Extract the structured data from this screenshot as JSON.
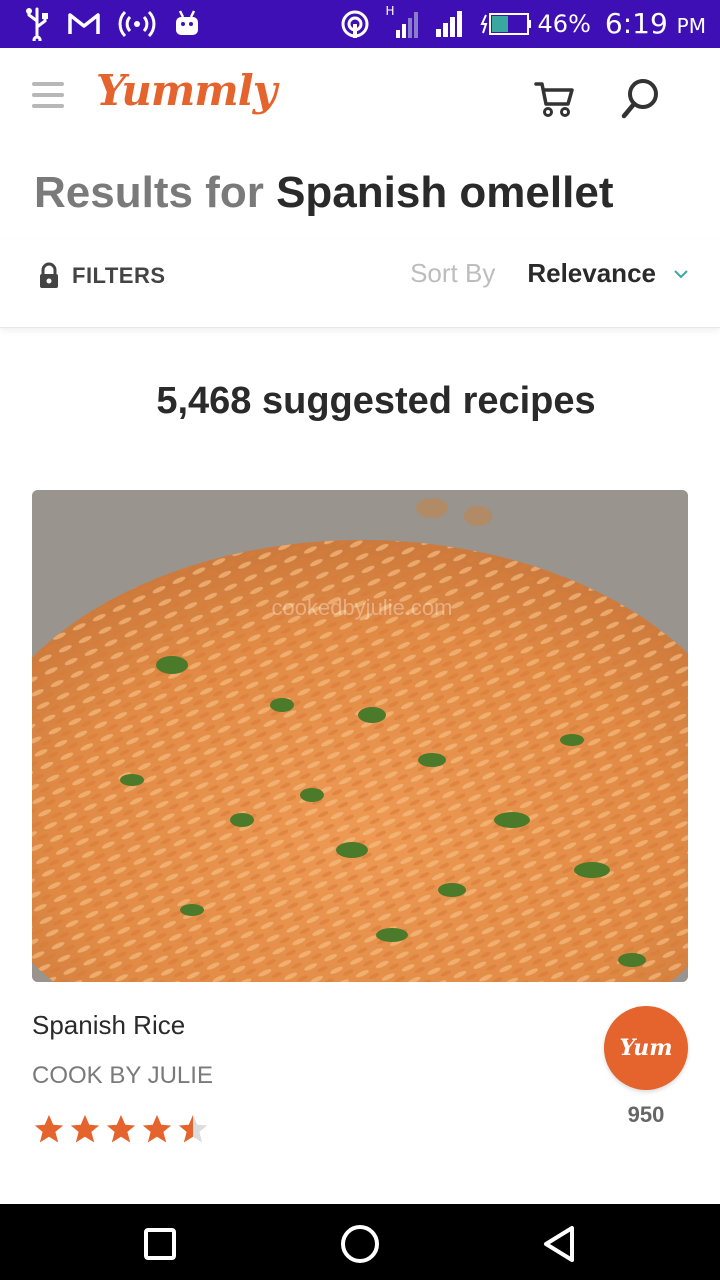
{
  "status_bar": {
    "battery": "46%",
    "time": "6:19",
    "ampm": "PM",
    "network_label": "H"
  },
  "app": {
    "logo": "Yummly",
    "brand_color": "#e5632c"
  },
  "results": {
    "prefix": "Results for",
    "query": "Spanish omellet"
  },
  "filter_bar": {
    "filters_label": "FILTERS",
    "sort_label": "Sort By",
    "sort_value": "Relevance"
  },
  "count_text": "5,468 suggested recipes",
  "recipe": {
    "title": "Spanish Rice",
    "source": "COOK BY JULIE",
    "rating": 4.5,
    "rating_max": 5,
    "yum_label": "Yum",
    "yum_count": "950",
    "image_watermark": "cookedbyjulie.com"
  },
  "icons": {
    "menu": "hamburger-menu-icon",
    "cart": "shopping-cart-icon",
    "search": "search-icon",
    "lock": "lock-icon",
    "chevron": "chevron-down-icon",
    "nav_recent": "square-icon",
    "nav_home": "circle-icon",
    "nav_back": "triangle-back-icon"
  }
}
